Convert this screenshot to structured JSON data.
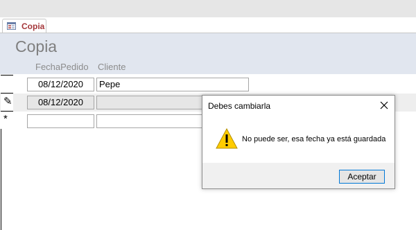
{
  "tab": {
    "label": "Copia"
  },
  "form": {
    "title": "Copia",
    "columns": [
      "FechaPedido",
      "Cliente"
    ],
    "rows": [
      {
        "selector": "",
        "fecha": "08/12/2020",
        "cliente": "Pepe"
      },
      {
        "selector": "✎",
        "fecha": "08/12/2020",
        "cliente": ""
      },
      {
        "selector": "*",
        "fecha": "",
        "cliente": ""
      }
    ]
  },
  "dialog": {
    "title": "Debes cambiarla",
    "message": "No puede ser, esa fecha ya está guardada",
    "button": "Aceptar",
    "close_icon": "close-icon",
    "warning_icon": "warning-icon"
  },
  "colors": {
    "tab_accent": "#a4373a",
    "header_bg": "#e1e6ef",
    "warning": "#ffcc00"
  }
}
